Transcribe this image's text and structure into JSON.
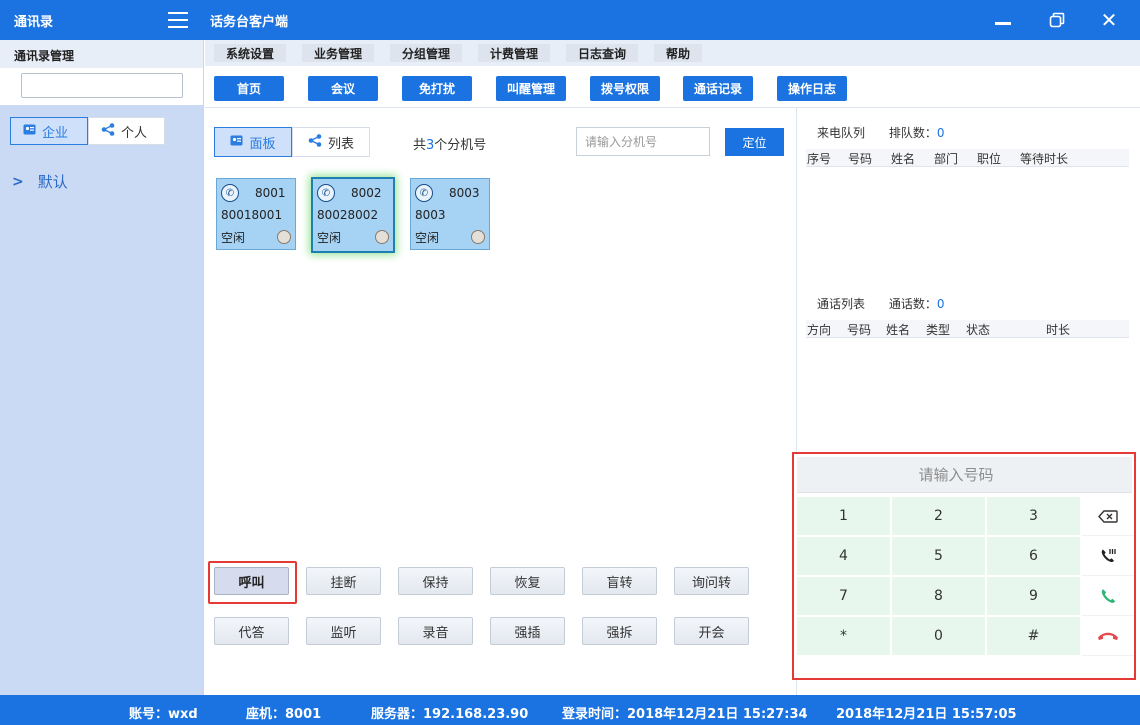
{
  "titlebar": {
    "left_title": "通讯录",
    "title": "话务台客户端"
  },
  "left_panel": {
    "header": "通讯录管理",
    "search_value": "",
    "tabs": [
      {
        "label": "企业",
        "icon": "contact-card-icon",
        "active": true
      },
      {
        "label": "个人",
        "icon": "share-icon",
        "active": false
      }
    ],
    "tree": [
      {
        "label": "默认"
      }
    ]
  },
  "menu": [
    "系统设置",
    "业务管理",
    "分组管理",
    "计费管理",
    "日志查询",
    "帮助"
  ],
  "toolbar": [
    "首页",
    "会议",
    "免打扰",
    "叫醒管理",
    "拨号权限",
    "通话记录",
    "操作日志"
  ],
  "view_tabs": [
    {
      "label": "面板",
      "icon": "contact-card-icon",
      "active": true
    },
    {
      "label": "列表",
      "icon": "share-icon",
      "active": false
    }
  ],
  "ext_count": {
    "prefix": "共",
    "count": "3",
    "suffix": "个分机号"
  },
  "ext_search": {
    "placeholder": "请输入分机号",
    "value": ""
  },
  "locate_button": "定位",
  "extensions": [
    {
      "ext": "8001",
      "number": "80018001",
      "status": "空闲",
      "selected": false
    },
    {
      "ext": "8002",
      "number": "80028002",
      "status": "空闲",
      "selected": true
    },
    {
      "ext": "8003",
      "number": "8003",
      "status": "空闲",
      "selected": false
    }
  ],
  "actions_row1": [
    "呼叫",
    "挂断",
    "保持",
    "恢复",
    "盲转",
    "询问转"
  ],
  "actions_row2": [
    "代答",
    "监听",
    "录音",
    "强插",
    "强拆",
    "开会"
  ],
  "incoming_queue": {
    "title": "来电队列",
    "count_label": "排队数：",
    "count": "0",
    "columns": [
      "序号",
      "号码",
      "姓名",
      "部门",
      "职位",
      "等待时长"
    ]
  },
  "call_list": {
    "title": "通话列表",
    "count_label": "通话数：",
    "count": "0",
    "columns": [
      "方向",
      "号码",
      "姓名",
      "类型",
      "状态",
      "时长"
    ]
  },
  "dialpad": {
    "placeholder": "请输入号码",
    "keys": [
      "1",
      "2",
      "3",
      "4",
      "5",
      "6",
      "7",
      "8",
      "9",
      "*",
      "0",
      "#"
    ],
    "fn_keys": [
      "backspace-icon",
      "call-transfer-icon",
      "call-answer-icon",
      "hangup-icon"
    ],
    "colors": {
      "answer": "#2bb673",
      "hangup": "#e5484d"
    }
  },
  "statusbar": {
    "account": "账号：wxd",
    "seat": "座机：8001",
    "server": "服务器：192.168.23.90",
    "login_time": "登录时间：2018年12月21日 15:27:34",
    "now": "2018年12月21日 15:57:05"
  },
  "colors": {
    "primary": "#1a73e0",
    "card": "#a6d2f4",
    "highlight": "#e53935"
  }
}
